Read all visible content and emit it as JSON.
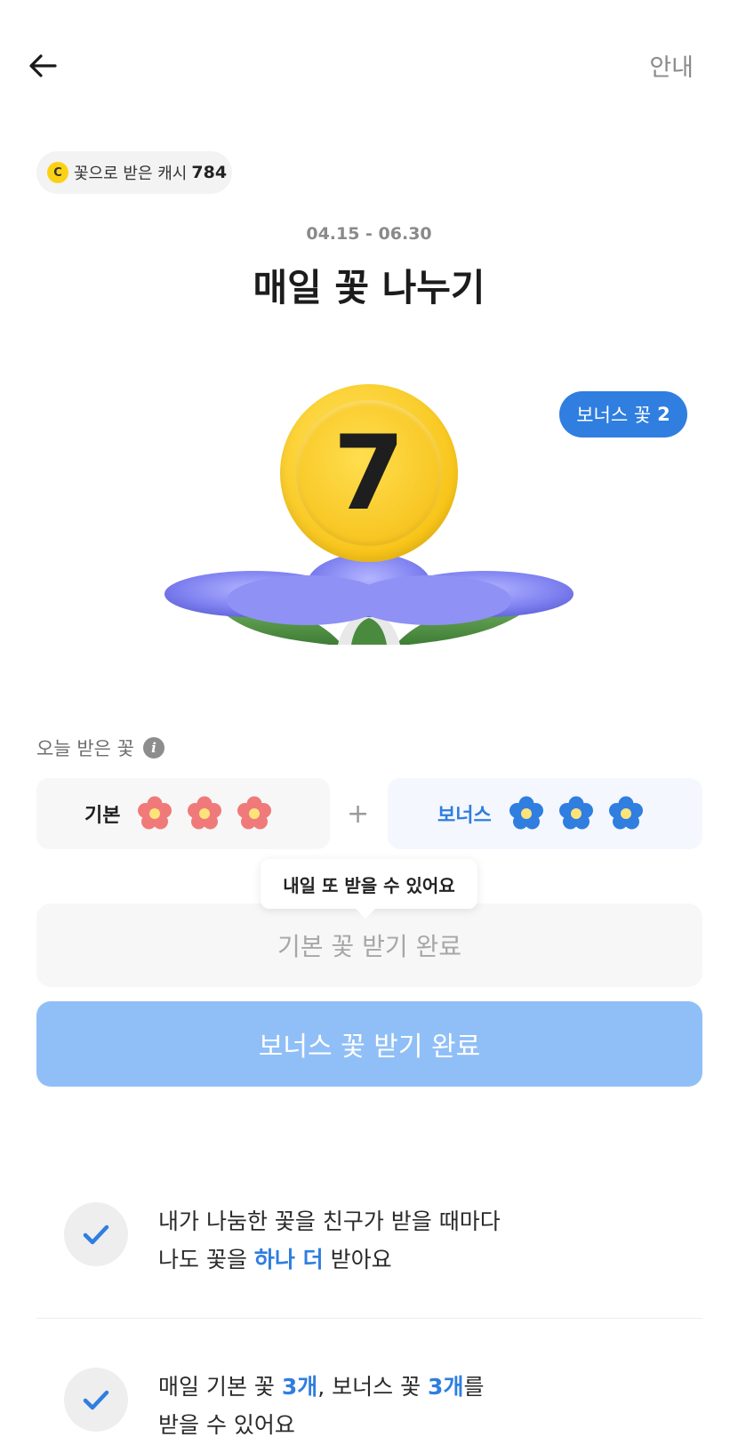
{
  "header": {
    "back_icon": "arrow-left-icon",
    "guide_label": "안내"
  },
  "cash": {
    "icon_letter": "C",
    "label": "꽃으로 받은 캐시",
    "value": "784"
  },
  "event": {
    "period": "04.15 - 06.30",
    "title": "매일 꽃 나누기"
  },
  "bonus_badge": {
    "label": "보너스 꽃",
    "count": "2"
  },
  "coin": {
    "count": "7"
  },
  "today": {
    "label": "오늘 받은 꽃",
    "info_icon": "i",
    "basic_label": "기본",
    "basic_count": 3,
    "plus": "+",
    "bonus_label": "보너스",
    "bonus_count": 3
  },
  "tooltip": "내일 또 받을 수 있어요",
  "buttons": {
    "basic_done": "기본 꽃 받기 완료",
    "bonus_done": "보너스 꽃 받기 완료"
  },
  "features": [
    {
      "line1": "내가 나눔한 꽃을 친구가 받을 때마다",
      "line2_pre": "나도 꽃을 ",
      "line2_hl": "하나 더",
      "line2_post": " 받아요"
    },
    {
      "line1_a": "매일 기본 꽃 ",
      "line1_hl1": "3개",
      "line1_b": ", 보너스 꽃 ",
      "line1_hl2": "3개",
      "line1_c": "를",
      "line2": "받을 수 있어요"
    }
  ],
  "colors": {
    "accent": "#2f7ee0",
    "basic_flower": "#f07a7a",
    "bonus_flower": "#2f7ee0",
    "coin": "#f8c51a",
    "bonus_button": "#90bff7"
  }
}
